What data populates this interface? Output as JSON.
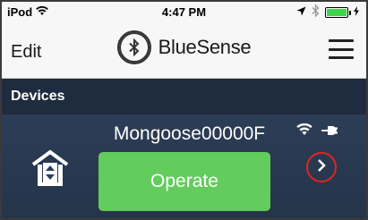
{
  "status_bar": {
    "carrier": "iPod",
    "time": "4:47 PM",
    "battery_level": 1.0
  },
  "nav": {
    "edit_label": "Edit",
    "title": "BlueSense",
    "icons": [
      "wifi-icon",
      "bluetooth-logo-icon",
      "hamburger-menu-icon",
      "location-arrow-icon",
      "bluetooth-icon",
      "battery-icon"
    ]
  },
  "section": {
    "title": "Devices"
  },
  "devices": [
    {
      "name": "Mongoose00000F",
      "action_label": "Operate",
      "icons": [
        "house-up-down-icon",
        "wifi-icon",
        "plug-icon",
        "chevron-right-icon"
      ]
    }
  ],
  "colors": {
    "nav_background": "#f7f7f7",
    "section_background": "#1f2b3e",
    "device_background": "#2c3d56",
    "operate_button": "#62cc5d",
    "highlight_circle": "#e02424",
    "battery_fill": "#3fd34a"
  }
}
